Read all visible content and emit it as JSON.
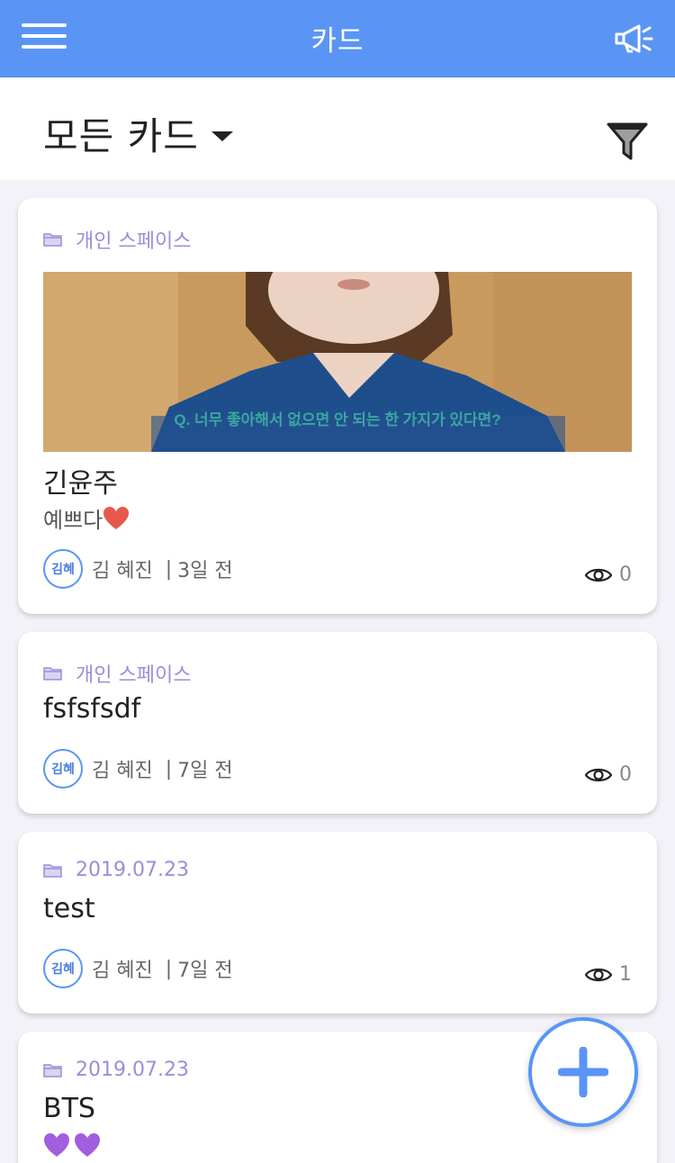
{
  "appbar": {
    "title": "카드",
    "menu_icon": "hamburger-menu-icon",
    "notice_icon": "megaphone-icon"
  },
  "filter": {
    "selected": "모든 카드",
    "funnel_icon": "funnel-icon"
  },
  "cards": [
    {
      "space": "개인 스페이스",
      "title": "긴윤주",
      "desc": "예쁘다",
      "desc_emoji": "red-heart",
      "thumb_caption": "Q. 너무 좋아해서 없으면 안 되는 한 가지가 있다면?",
      "avatar": "김혜",
      "author": "김 혜진",
      "sep": "|",
      "time": "3일 전",
      "views": "0"
    },
    {
      "space": "개인 스페이스",
      "title": "fsfsfsdf",
      "avatar": "김혜",
      "author": "김 혜진",
      "sep": "|",
      "time": "7일 전",
      "views": "0"
    },
    {
      "space": "2019.07.23",
      "title": "test",
      "avatar": "김혜",
      "author": "김 혜진",
      "sep": "|",
      "time": "7일 전",
      "views": "1"
    },
    {
      "space": "2019.07.23",
      "title": "BTS",
      "desc_emoji": "purple-hearts"
    }
  ],
  "colors": {
    "primary": "#5a95f5",
    "space_text": "#9a8fd6",
    "background": "#f3f2f8"
  },
  "fab": {
    "icon": "plus-icon"
  }
}
